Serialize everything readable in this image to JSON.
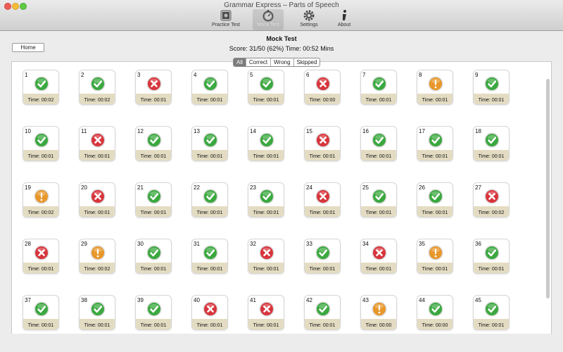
{
  "window": {
    "title": "Grammar Express – Parts of Speech"
  },
  "toolbar": [
    {
      "id": "practice-test",
      "label": "Practice Test",
      "icon": "practice-test-icon",
      "selected": false
    },
    {
      "id": "mock-test",
      "label": "Mock Test",
      "icon": "mock-test-icon",
      "selected": true
    },
    {
      "id": "settings",
      "label": "Settings",
      "icon": "gear-icon",
      "selected": false
    },
    {
      "id": "about",
      "label": "About",
      "icon": "info-icon",
      "selected": false
    }
  ],
  "home_label": "Home",
  "page_title": "Mock Test",
  "score_text": "Score: 31/50 (62%) Time: 00:52 Mins",
  "filters": [
    {
      "label": "All",
      "active": true
    },
    {
      "label": "Correct",
      "active": false
    },
    {
      "label": "Wrong",
      "active": false
    },
    {
      "label": "Skipped",
      "active": false
    }
  ],
  "status_colors": {
    "correct": "#3aa83e",
    "wrong": "#d8343c",
    "skipped": "#e8972a"
  },
  "questions": [
    {
      "num": "1",
      "status": "correct",
      "time": "Time: 00:02"
    },
    {
      "num": "2",
      "status": "correct",
      "time": "Time: 00:02"
    },
    {
      "num": "3",
      "status": "wrong",
      "time": "Time: 00:01"
    },
    {
      "num": "4",
      "status": "correct",
      "time": "Time: 00:01"
    },
    {
      "num": "5",
      "status": "correct",
      "time": "Time: 00:01"
    },
    {
      "num": "6",
      "status": "wrong",
      "time": "Time: 00:00"
    },
    {
      "num": "7",
      "status": "correct",
      "time": "Time: 00:01"
    },
    {
      "num": "8",
      "status": "skipped",
      "time": "Time: 00:01"
    },
    {
      "num": "9",
      "status": "correct",
      "time": "Time: 00:01"
    },
    {
      "num": "10",
      "status": "correct",
      "time": "Time: 00:01"
    },
    {
      "num": "11",
      "status": "wrong",
      "time": "Time: 00:01"
    },
    {
      "num": "12",
      "status": "correct",
      "time": "Time: 00:01"
    },
    {
      "num": "13",
      "status": "correct",
      "time": "Time: 00:01"
    },
    {
      "num": "14",
      "status": "correct",
      "time": "Time: 00:01"
    },
    {
      "num": "15",
      "status": "wrong",
      "time": "Time: 00:01"
    },
    {
      "num": "16",
      "status": "correct",
      "time": "Time: 00:01"
    },
    {
      "num": "17",
      "status": "correct",
      "time": "Time: 00:01"
    },
    {
      "num": "18",
      "status": "correct",
      "time": "Time: 00:01"
    },
    {
      "num": "19",
      "status": "skipped",
      "time": "Time: 00:02"
    },
    {
      "num": "20",
      "status": "wrong",
      "time": "Time: 00:01"
    },
    {
      "num": "21",
      "status": "correct",
      "time": "Time: 00:01"
    },
    {
      "num": "22",
      "status": "correct",
      "time": "Time: 00:01"
    },
    {
      "num": "23",
      "status": "correct",
      "time": "Time: 00:01"
    },
    {
      "num": "24",
      "status": "wrong",
      "time": "Time: 00:01"
    },
    {
      "num": "25",
      "status": "correct",
      "time": "Time: 00:01"
    },
    {
      "num": "26",
      "status": "correct",
      "time": "Time: 00:01"
    },
    {
      "num": "27",
      "status": "wrong",
      "time": "Time: 00:02"
    },
    {
      "num": "28",
      "status": "wrong",
      "time": "Time: 00:01"
    },
    {
      "num": "29",
      "status": "skipped",
      "time": "Time: 00:02"
    },
    {
      "num": "30",
      "status": "correct",
      "time": "Time: 00:01"
    },
    {
      "num": "31",
      "status": "correct",
      "time": "Time: 00:01"
    },
    {
      "num": "32",
      "status": "wrong",
      "time": "Time: 00:01"
    },
    {
      "num": "33",
      "status": "correct",
      "time": "Time: 00:01"
    },
    {
      "num": "34",
      "status": "wrong",
      "time": "Time: 00:01"
    },
    {
      "num": "35",
      "status": "skipped",
      "time": "Time: 00:01"
    },
    {
      "num": "36",
      "status": "correct",
      "time": "Time: 00:01"
    },
    {
      "num": "37",
      "status": "correct",
      "time": "Time: 00:01"
    },
    {
      "num": "38",
      "status": "correct",
      "time": "Time: 00:01"
    },
    {
      "num": "39",
      "status": "correct",
      "time": "Time: 00:01"
    },
    {
      "num": "40",
      "status": "wrong",
      "time": "Time: 00:01"
    },
    {
      "num": "41",
      "status": "wrong",
      "time": "Time: 00:01"
    },
    {
      "num": "42",
      "status": "correct",
      "time": "Time: 00:01"
    },
    {
      "num": "43",
      "status": "skipped",
      "time": "Time: 00:00"
    },
    {
      "num": "44",
      "status": "correct",
      "time": "Time: 00:00"
    },
    {
      "num": "45",
      "status": "correct",
      "time": "Time: 00:01"
    }
  ]
}
